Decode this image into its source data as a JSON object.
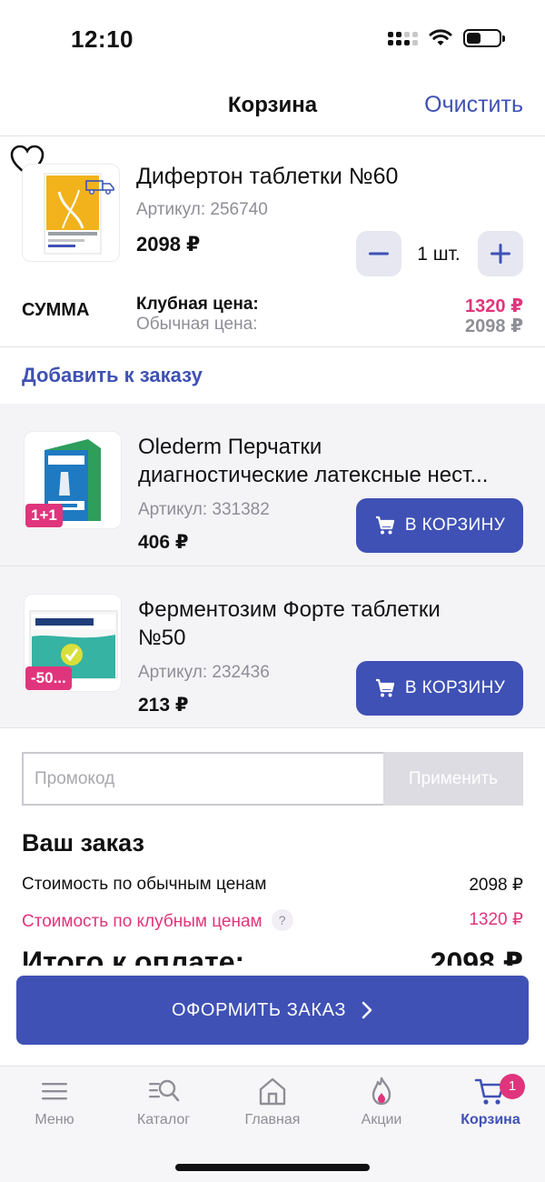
{
  "status_bar": {
    "time": "12:10"
  },
  "header": {
    "title": "Корзина",
    "clear_label": "Очистить"
  },
  "cart_item": {
    "name": "Дифертон таблетки №60",
    "sku": "Артикул: 256740",
    "price": "2098 ₽",
    "quantity": "1 шт.",
    "sum_label": "СУММА",
    "club_price_label": "Клубная цена:",
    "regular_price_label": "Обычная цена:",
    "club_price": "1320 ₽",
    "regular_price": "2098 ₽"
  },
  "add_to_order": {
    "title": "Добавить к заказу",
    "items": [
      {
        "name_line1": "Olederm Перчатки",
        "name_line2": "диагностические латексные нест...",
        "sku": "Артикул: 331382",
        "price": "406 ₽",
        "badge": "1+1",
        "button": "В КОРЗИНУ"
      },
      {
        "name_line1": "Ферментозим Форте таблетки",
        "name_line2": "№50",
        "sku": "Артикул: 232436",
        "price": "213 ₽",
        "badge": "-50...",
        "button": "В КОРЗИНУ"
      }
    ]
  },
  "promo": {
    "placeholder": "Промокод",
    "apply_label": "Применить"
  },
  "order": {
    "title": "Ваш заказ",
    "regular_label": "Стоимость по обычным ценам",
    "regular_value": "2098 ₽",
    "club_label": "Стоимость по клубным ценам",
    "club_help": "?",
    "club_value": "1320 ₽",
    "total_label": "Итого к оплате:",
    "total_value": "2098 ₽"
  },
  "checkout": {
    "label": "ОФОРМИТЬ ЗАКАЗ"
  },
  "tab_bar": {
    "items": [
      {
        "label": "Меню",
        "icon": "menu-icon"
      },
      {
        "label": "Каталог",
        "icon": "catalog-search-icon"
      },
      {
        "label": "Главная",
        "icon": "home-icon"
      },
      {
        "label": "Акции",
        "icon": "flame-icon"
      },
      {
        "label": "Корзина",
        "icon": "cart-icon"
      }
    ],
    "cart_badge": "1",
    "active": "Корзина"
  },
  "colors": {
    "accent": "#3f51b5",
    "club": "#e0357c",
    "muted": "#8e8e96"
  }
}
